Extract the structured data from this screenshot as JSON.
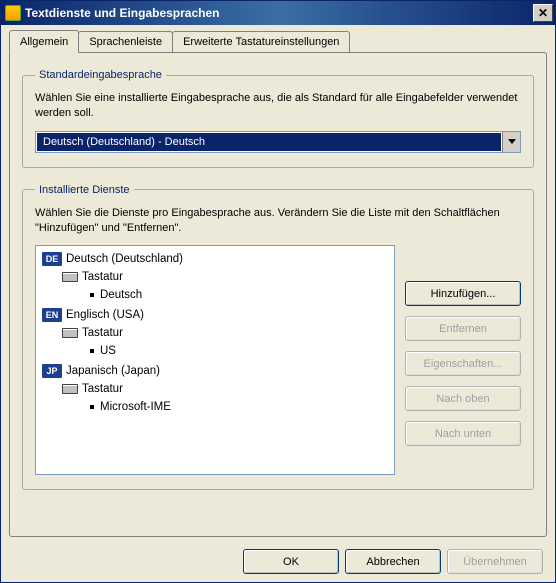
{
  "window": {
    "title": "Textdienste und Eingabesprachen",
    "close_glyph": "✕"
  },
  "tabs": [
    {
      "label": "Allgemein",
      "active": true
    },
    {
      "label": "Sprachenleiste",
      "active": false
    },
    {
      "label": "Erweiterte Tastatureinstellungen",
      "active": false
    }
  ],
  "default_group": {
    "legend": "Standardeingabesprache",
    "description": "Wählen Sie eine installierte Eingabesprache aus, die als Standard für alle Eingabefelder verwendet werden soll.",
    "dropdown_selected": "Deutsch (Deutschland) - Deutsch"
  },
  "installed_group": {
    "legend": "Installierte Dienste",
    "description": "Wählen Sie die Dienste pro Eingabesprache aus. Verändern Sie die Liste mit den Schaltflächen \"Hinzufügen\" und \"Entfernen\".",
    "languages": [
      {
        "code": "DE",
        "name": "Deutsch (Deutschland)",
        "category": "Tastatur",
        "layouts": [
          "Deutsch"
        ]
      },
      {
        "code": "EN",
        "name": "Englisch (USA)",
        "category": "Tastatur",
        "layouts": [
          "US"
        ]
      },
      {
        "code": "JP",
        "name": "Japanisch (Japan)",
        "category": "Tastatur",
        "layouts": [
          "Microsoft-IME"
        ]
      }
    ],
    "buttons": {
      "add": "Hinzufügen...",
      "remove": "Entfernen",
      "properties": "Eigenschaften...",
      "move_up": "Nach oben",
      "move_down": "Nach unten"
    }
  },
  "dialog_buttons": {
    "ok": "OK",
    "cancel": "Abbrechen",
    "apply": "Übernehmen"
  }
}
